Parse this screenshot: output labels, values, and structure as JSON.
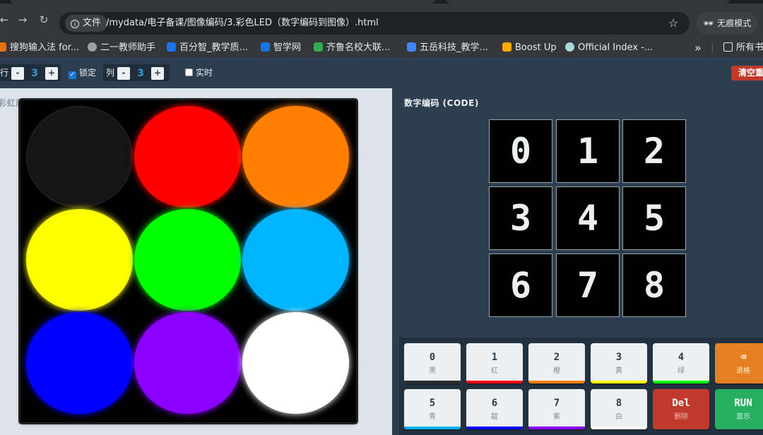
{
  "browser": {
    "url_chip": "文件",
    "url": "/mydata/电子备课/图像编码/3.彩色LED（数字编码到图像）.html",
    "incognito": "无痕模式",
    "bookmarks": [
      {
        "label": "搜狗输入法 for...",
        "icon_color": "#e8710a"
      },
      {
        "label": "二一教师助手",
        "icon_color": "#9aa0a6"
      },
      {
        "label": "百分智_教学质...",
        "icon_color": "#1a73e8"
      },
      {
        "label": "智学网",
        "icon_color": "#1a73e8"
      },
      {
        "label": "齐鲁名校大联...",
        "icon_color": "#34a853"
      },
      {
        "label": "五岳科技_教学...",
        "icon_color": "#4285f4"
      },
      {
        "label": "Boost Up",
        "icon_color": "#f9ab00"
      },
      {
        "label": "Official Index -...",
        "icon_color": "#a8dadc"
      }
    ],
    "bookmarks_overflow": "»",
    "all_bookmarks": "所有书"
  },
  "toolbar": {
    "rows_label": "行",
    "rows_value": "3",
    "lock_label": "锁定",
    "lock_checked": true,
    "cols_label": "列",
    "cols_value": "3",
    "realtime_label": "实时",
    "realtime_checked": false,
    "minus": "-",
    "plus": "+",
    "clear_label": "清空重置"
  },
  "visual": {
    "title": "彩虹屏幕 (VISUAL)",
    "leds": [
      {
        "color": "#151515"
      },
      {
        "color": "#ff0000"
      },
      {
        "color": "#ff7f00"
      },
      {
        "color": "#ffff00"
      },
      {
        "color": "#00ff00"
      },
      {
        "color": "#00b4ff"
      },
      {
        "color": "#0000ff"
      },
      {
        "color": "#8b00ff"
      },
      {
        "color": "#ffffff"
      }
    ]
  },
  "code": {
    "title": "数字编码 (CODE)",
    "cells": [
      "0",
      "1",
      "2",
      "3",
      "4",
      "5",
      "6",
      "7",
      "8"
    ]
  },
  "keypad": {
    "keys": [
      {
        "digit": "0",
        "color_name": "黑",
        "bar": "#2c2c2c"
      },
      {
        "digit": "1",
        "color_name": "红",
        "bar": "#ff0000"
      },
      {
        "digit": "2",
        "color_name": "橙",
        "bar": "#ff7f00"
      },
      {
        "digit": "3",
        "color_name": "黄",
        "bar": "#ffff00"
      },
      {
        "digit": "4",
        "color_name": "绿",
        "bar": "#00ff00"
      },
      {
        "digit": "5",
        "color_name": "青",
        "bar": "#00b4ff"
      },
      {
        "digit": "6",
        "color_name": "靛",
        "bar": "#0000ff"
      },
      {
        "digit": "7",
        "color_name": "紫",
        "bar": "#8b00ff"
      },
      {
        "digit": "8",
        "color_name": "白",
        "bar": "#ffffff"
      }
    ],
    "backspace": {
      "icon": "⌫",
      "label": "退格"
    },
    "delete": {
      "title": "Del",
      "label": "删除"
    },
    "run": {
      "title": "RUN",
      "label": "显示"
    }
  }
}
